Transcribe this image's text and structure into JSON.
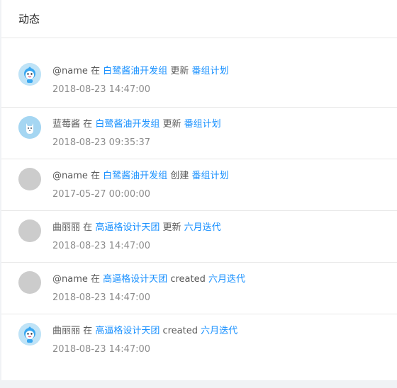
{
  "card": {
    "title": "动态"
  },
  "activities": [
    {
      "avatar": "avatar-a-icon",
      "user": "@name",
      "in": "在",
      "group": "白鹭酱油开发组",
      "action": "更新",
      "project": "番组计划",
      "time": "2018-08-23 14:47:00"
    },
    {
      "avatar": "avatar-b-icon",
      "user": "蓝莓酱",
      "in": "在",
      "group": "白鹭酱油开发组",
      "action": "更新",
      "project": "番组计划",
      "time": "2018-08-23 09:35:37"
    },
    {
      "avatar": "avatar-placeholder",
      "user": "@name",
      "in": "在",
      "group": "白鹭酱油开发组",
      "action": "创建",
      "project": "番组计划",
      "time": "2017-05-27 00:00:00"
    },
    {
      "avatar": "avatar-placeholder",
      "user": "曲丽丽",
      "in": "在",
      "group": "高逼格设计天团",
      "action": "更新",
      "project": "六月迭代",
      "time": "2018-08-23 14:47:00"
    },
    {
      "avatar": "avatar-placeholder",
      "user": "@name",
      "in": "在",
      "group": "高逼格设计天团",
      "action": "created",
      "project": "六月迭代",
      "time": "2018-08-23 14:47:00"
    },
    {
      "avatar": "avatar-a-icon",
      "user": "曲丽丽",
      "in": "在",
      "group": "高逼格设计天团",
      "action": "created",
      "project": "六月迭代",
      "time": "2018-08-23 14:47:00"
    }
  ],
  "colors": {
    "link": "#1890ff",
    "text": "#595959",
    "time": "#8c8c8c",
    "placeholder": "#cccccc"
  }
}
